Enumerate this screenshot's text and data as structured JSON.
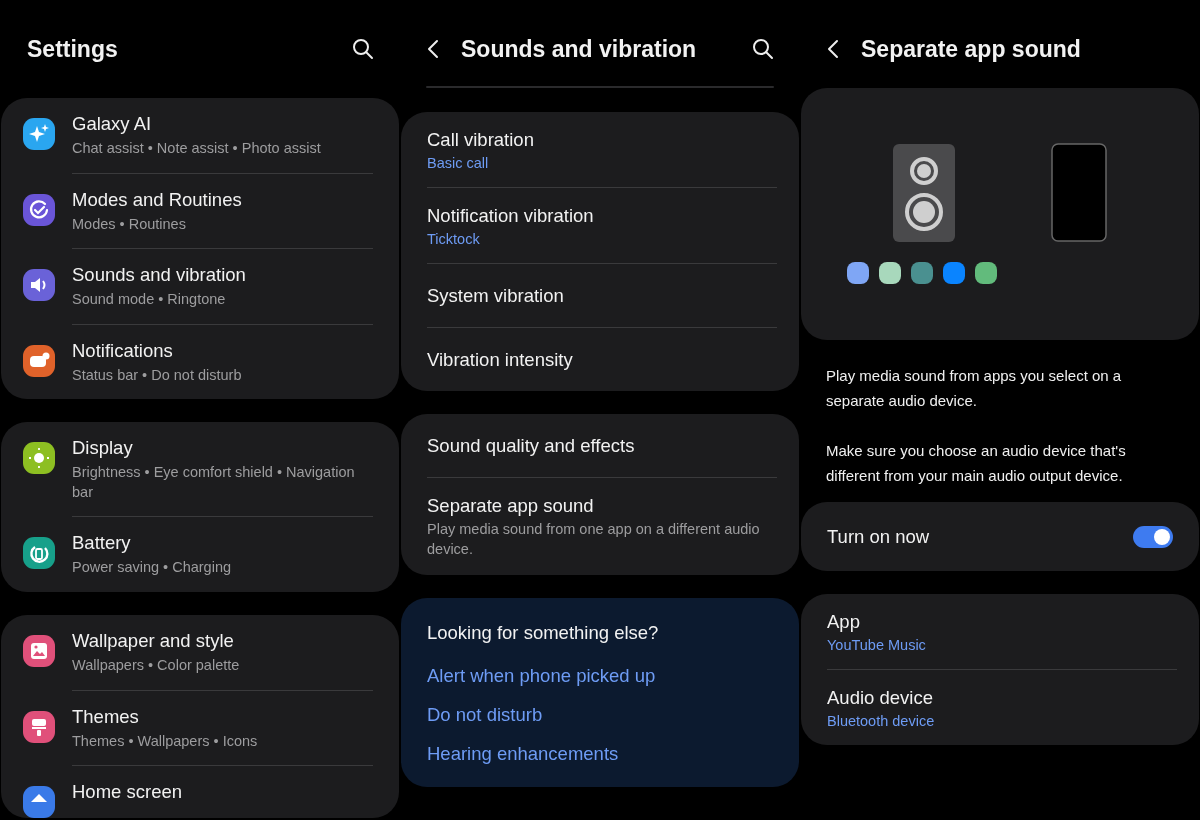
{
  "settings": {
    "title": "Settings",
    "groups": [
      {
        "items": [
          {
            "title": "Galaxy AI",
            "subtitle": "Chat assist • Note assist • Photo assist",
            "color": "#2aa6f0"
          },
          {
            "title": "Modes and Routines",
            "subtitle": "Modes • Routines",
            "color": "#6a55d8"
          },
          {
            "title": "Sounds and vibration",
            "subtitle": "Sound mode • Ringtone",
            "color": "#6a62d8"
          },
          {
            "title": "Notifications",
            "subtitle": "Status bar • Do not disturb",
            "color": "#e0622a"
          }
        ]
      },
      {
        "items": [
          {
            "title": "Display",
            "subtitle": "Brightness • Eye comfort shield • Navigation bar",
            "color": "#8dbf22"
          },
          {
            "title": "Battery",
            "subtitle": "Power saving • Charging",
            "color": "#17a08a"
          }
        ]
      },
      {
        "items": [
          {
            "title": "Wallpaper and style",
            "subtitle": "Wallpapers • Color palette",
            "color": "#e0507a"
          },
          {
            "title": "Themes",
            "subtitle": "Themes • Wallpapers • Icons",
            "color": "#e0507a"
          },
          {
            "title": "Home screen",
            "color": "#3a7ae8"
          }
        ]
      }
    ]
  },
  "sounds": {
    "title": "Sounds and vibration",
    "groups": [
      {
        "items": [
          {
            "title": "Call vibration",
            "value": "Basic call"
          },
          {
            "title": "Notification vibration",
            "value": "Ticktock"
          },
          {
            "title": "System vibration"
          },
          {
            "title": "Vibration intensity"
          }
        ]
      },
      {
        "items": [
          {
            "title": "Sound quality and effects"
          },
          {
            "title": "Separate app sound",
            "description": "Play media sound from one app on a different audio device."
          }
        ]
      }
    ],
    "suggestions": {
      "title": "Looking for something else?",
      "links": [
        "Alert when phone picked up",
        "Do not disturb",
        "Hearing enhancements"
      ]
    }
  },
  "separate": {
    "title": "Separate app sound",
    "swatches": [
      {
        "color": "#7fa6f5"
      },
      {
        "color": "#a8d8bc"
      },
      {
        "color": "#4a9090"
      },
      {
        "color": "#0a84ff"
      },
      {
        "color": "#62bb7c"
      }
    ],
    "paragraphs": [
      "Play media sound from apps you select on a separate audio device.",
      "Make sure you choose an audio device that's different from your main audio output device."
    ],
    "toggle": {
      "label": "Turn on now",
      "on": true
    },
    "items": [
      {
        "title": "App",
        "value": "YouTube Music"
      },
      {
        "title": "Audio device",
        "value": "Bluetooth device"
      }
    ]
  }
}
